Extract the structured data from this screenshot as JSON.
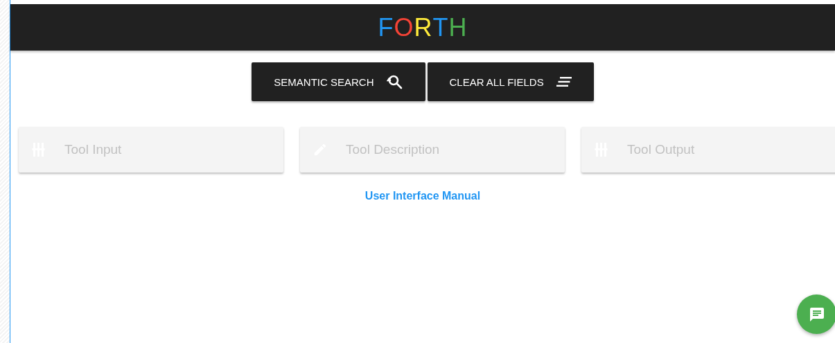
{
  "header": {
    "logo_letters": [
      {
        "char": "F",
        "color": "#2196f3"
      },
      {
        "char": "O",
        "color": "#f44336"
      },
      {
        "char": "R",
        "color": "#ffeb3b"
      },
      {
        "char": "T",
        "color": "#2196f3"
      },
      {
        "char": "H",
        "color": "#4caf50"
      }
    ]
  },
  "actions": [
    {
      "label": "SEMANTIC SEARCH",
      "kind": "search"
    },
    {
      "label": "CLEAR ALL FIELDS",
      "kind": "clear"
    }
  ],
  "fields": [
    {
      "placeholder": "Tool Input",
      "kind": "io"
    },
    {
      "placeholder": "Tool Description",
      "kind": "pencil"
    },
    {
      "placeholder": "Tool Output",
      "kind": "io"
    }
  ],
  "manual_link": "User Interface Manual"
}
